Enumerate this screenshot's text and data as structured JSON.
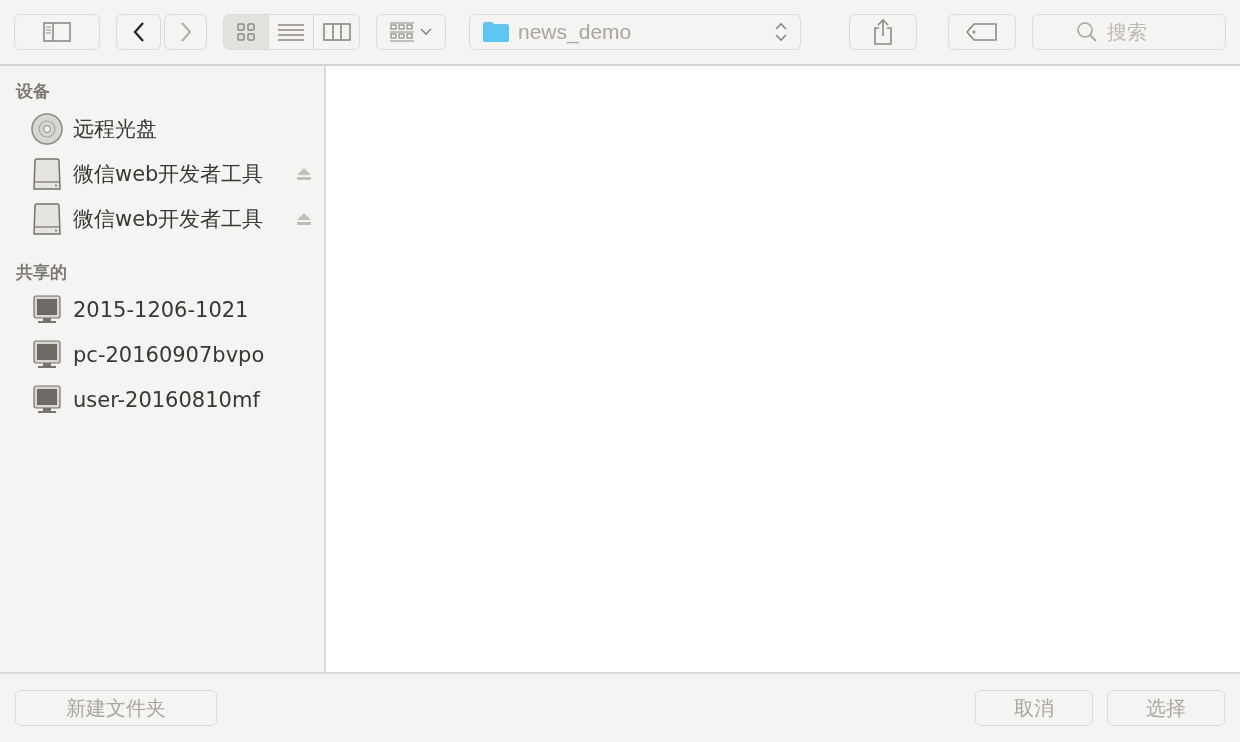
{
  "toolbar": {
    "back": {
      "disabled": false
    },
    "forward": {
      "disabled": true
    },
    "views": [
      {
        "kind": "icons",
        "selected": true
      },
      {
        "kind": "list",
        "selected": false
      },
      {
        "kind": "columns",
        "selected": false
      }
    ],
    "location": {
      "folder": "news_demo"
    },
    "search": {
      "placeholder": "搜索"
    }
  },
  "sidebar": {
    "sections": [
      {
        "title": "设备",
        "items": [
          {
            "kind": "disc",
            "label": "远程光盘",
            "ejectable": false
          },
          {
            "kind": "drive",
            "label": "微信web开发者工具",
            "ejectable": true
          },
          {
            "kind": "drive",
            "label": "微信web开发者工具",
            "ejectable": true
          }
        ]
      },
      {
        "title": "共享的",
        "items": [
          {
            "kind": "computer",
            "label": "2015-1206-1021",
            "ejectable": false
          },
          {
            "kind": "computer",
            "label": "pc-20160907bvpo",
            "ejectable": false
          },
          {
            "kind": "computer",
            "label": "user-20160810mf",
            "ejectable": false
          }
        ]
      }
    ]
  },
  "footer": {
    "buttons": [
      {
        "label": "新建文件夹",
        "disabled": true
      },
      {
        "label": "取消",
        "disabled": true
      },
      {
        "label": "选择",
        "disabled": true
      }
    ]
  }
}
